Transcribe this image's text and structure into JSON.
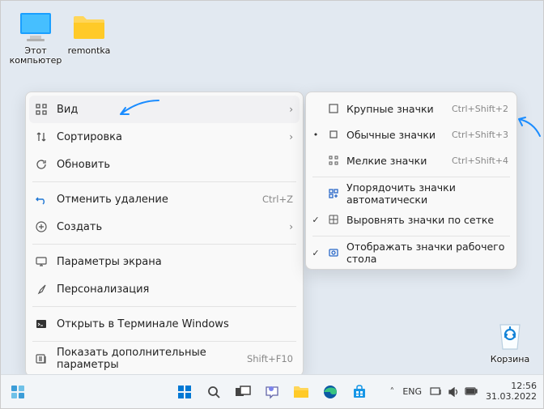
{
  "desktop": {
    "pc_label": "Этот компьютер",
    "folder_label": "remontka",
    "bin_label": "Корзина"
  },
  "context_main": {
    "view": "Вид",
    "sort": "Сортировка",
    "refresh": "Обновить",
    "undo": "Отменить удаление",
    "undo_hint": "Ctrl+Z",
    "new": "Создать",
    "display": "Параметры экрана",
    "personalize": "Персонализация",
    "terminal": "Открыть в Терминале Windows",
    "more": "Показать дополнительные параметры",
    "more_hint": "Shift+F10"
  },
  "context_sub": {
    "large": "Крупные значки",
    "large_hint": "Ctrl+Shift+2",
    "medium": "Обычные значки",
    "medium_hint": "Ctrl+Shift+3",
    "small": "Мелкие значки",
    "small_hint": "Ctrl+Shift+4",
    "auto": "Упорядочить значки автоматически",
    "grid": "Выровнять значки по сетке",
    "show": "Отображать значки рабочего стола"
  },
  "taskbar": {
    "lang": "ENG",
    "time": "12:56",
    "date": "31.03.2022"
  }
}
